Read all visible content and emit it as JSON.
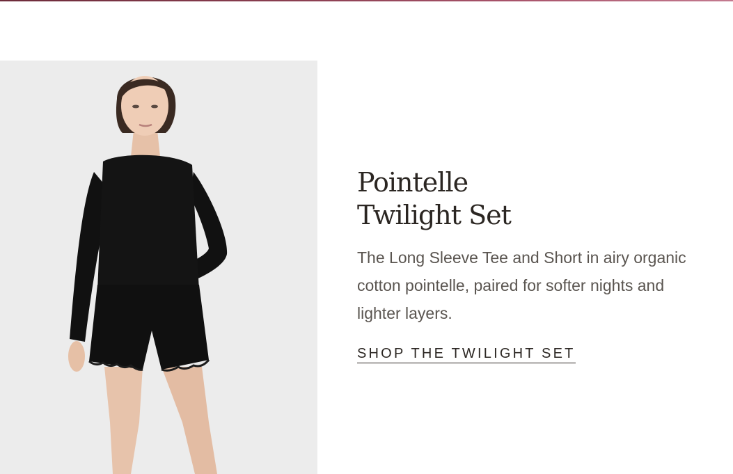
{
  "banner": {
    "title_line1": "Pointelle",
    "title_line2": "Twilight Set",
    "description": "The Long Sleeve Tee and Short in airy organic cotton pointelle, paired for softer nights and lighter layers.",
    "cta_label": "SHOP THE TWILIGHT SET"
  },
  "colors": {
    "accent_strip": "#8a3e50",
    "photo_background": "#ececec",
    "title_text": "#2b2622",
    "body_text": "#5a5550"
  }
}
